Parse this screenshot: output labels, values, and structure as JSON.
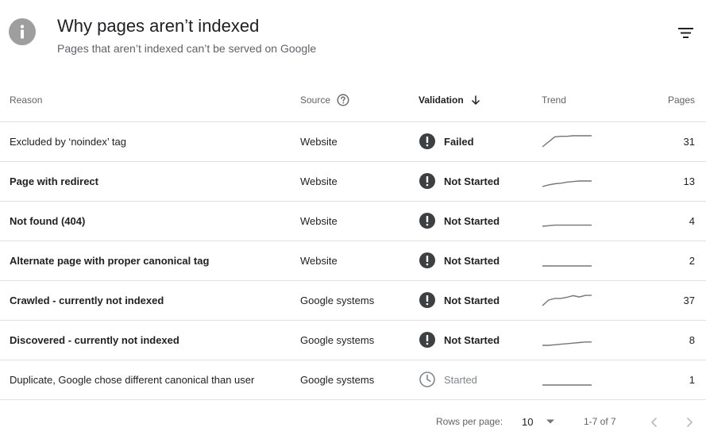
{
  "header": {
    "title": "Why pages aren’t indexed",
    "subtitle": "Pages that aren’t indexed can’t be served on Google"
  },
  "table": {
    "columns": {
      "reason": "Reason",
      "source": "Source",
      "validation": "Validation",
      "trend": "Trend",
      "pages": "Pages"
    },
    "rows": [
      {
        "reason": "Excluded by ‘noindex’ tag",
        "bold": false,
        "source": "Website",
        "validation": "Failed",
        "status": "alert",
        "trend": [
          1,
          0.55,
          0.1,
          0.05,
          0.05,
          0,
          0,
          0,
          0
        ],
        "pages": "31"
      },
      {
        "reason": "Page with redirect",
        "bold": true,
        "source": "Website",
        "validation": "Not Started",
        "status": "alert",
        "trend": [
          1,
          0.85,
          0.75,
          0.7,
          0.6,
          0.55,
          0.5,
          0.5,
          0.5
        ],
        "pages": "13"
      },
      {
        "reason": "Not found (404)",
        "bold": true,
        "source": "Website",
        "validation": "Not Started",
        "status": "alert",
        "trend": [
          1,
          0.95,
          0.9,
          0.9,
          0.9,
          0.9,
          0.9,
          0.9,
          0.9
        ],
        "pages": "4"
      },
      {
        "reason": "Alternate page with proper canonical tag",
        "bold": true,
        "source": "Website",
        "validation": "Not Started",
        "status": "alert",
        "trend": [
          1,
          1,
          1,
          1,
          1,
          1,
          1,
          1,
          1
        ],
        "pages": "2"
      },
      {
        "reason": "Crawled - currently not indexed",
        "bold": true,
        "source": "Google systems",
        "validation": "Not Started",
        "status": "alert",
        "trend": [
          1,
          0.5,
          0.35,
          0.35,
          0.25,
          0.1,
          0.22,
          0.08,
          0.08
        ],
        "pages": "37"
      },
      {
        "reason": "Discovered - currently not indexed",
        "bold": true,
        "source": "Google systems",
        "validation": "Not Started",
        "status": "alert",
        "trend": [
          1,
          1,
          0.95,
          0.9,
          0.85,
          0.8,
          0.75,
          0.7,
          0.7
        ],
        "pages": "8"
      },
      {
        "reason": "Duplicate, Google chose different canonical than user",
        "bold": false,
        "source": "Google systems",
        "validation": "Started",
        "status": "started",
        "trend": [
          1,
          1,
          1,
          1,
          1,
          1,
          1,
          1,
          1
        ],
        "pages": "1"
      }
    ]
  },
  "footer": {
    "rows_per_page_label": "Rows per page:",
    "rows_per_page_value": "10",
    "range": "1-7 of 7"
  },
  "icons": {
    "header": "info-icon",
    "filter": "filter-icon",
    "help": "help-circle-icon",
    "sort": "arrow-down-icon",
    "alert": "exclamation-circle-icon",
    "started": "clock-icon",
    "prev": "chevron-left-icon",
    "next": "chevron-right-icon"
  },
  "colors": {
    "alert_icon": "#3c4043",
    "started_icon": "#80868b",
    "trend_line": "#757575",
    "header_icon_bg": "#9e9e9e"
  }
}
